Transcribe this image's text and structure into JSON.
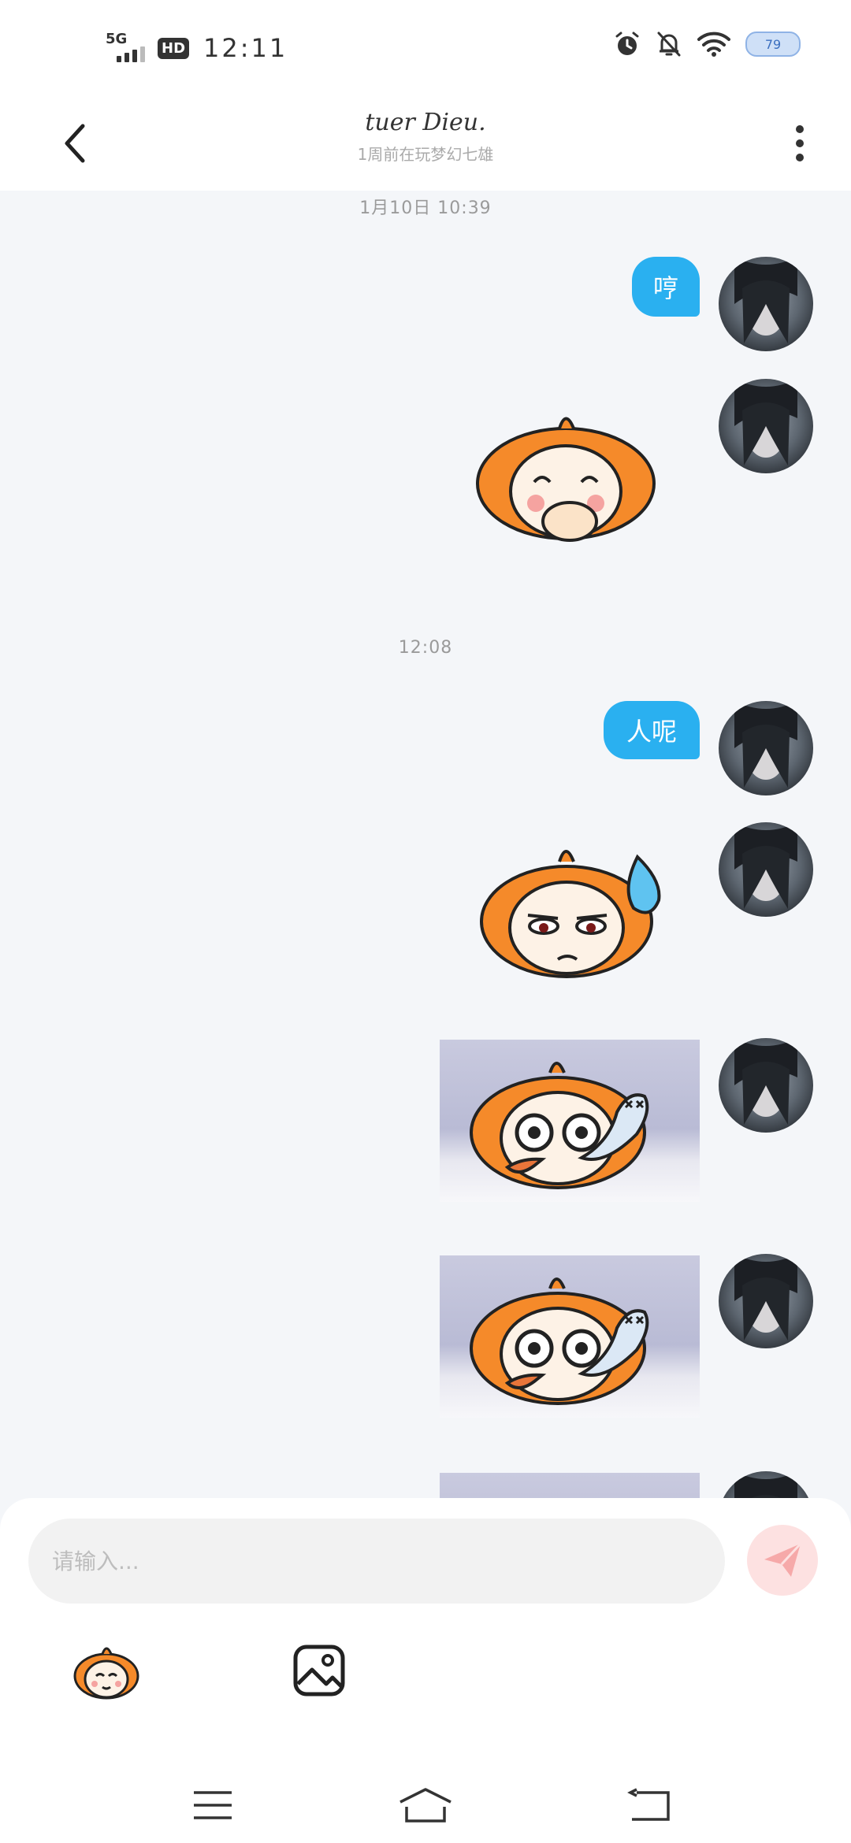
{
  "status_bar": {
    "network": "5G",
    "hd_label": "HD",
    "time": "12:11",
    "battery_level": "79",
    "icons": [
      "alarm-icon",
      "mute-bell-icon",
      "wifi-icon",
      "battery-icon"
    ]
  },
  "header": {
    "title": "tuer Dieu.",
    "subtitle": "1周前在玩梦幻七雄",
    "back_icon": "chevron-left-icon",
    "more_icon": "more-vertical-icon"
  },
  "messages": {
    "separator_1": "1月10日 10:39",
    "msg_1_text": "哼",
    "separator_2": "12:08",
    "msg_2_text": "人呢"
  },
  "input": {
    "placeholder": "请输入..."
  },
  "colors": {
    "bubble": "#2ab0f0",
    "send_button_bg": "#fde1e1",
    "send_icon": "#f6a9a9",
    "sticker_hair": "#f58a2a"
  }
}
